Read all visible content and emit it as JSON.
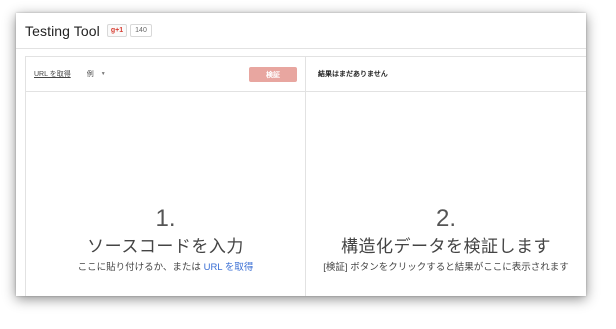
{
  "header": {
    "title": "Testing Tool",
    "gplus_label": "g+1",
    "plus_count": "140"
  },
  "left_pane": {
    "fetch_url_label": "URL を取得",
    "example_label": "例",
    "validate_label": "検証",
    "step_number": "1.",
    "step_title": "ソースコードを入力",
    "step_sub_prefix": "ここに貼り付けるか、または ",
    "step_sub_link": "URL を取得"
  },
  "right_pane": {
    "no_results_label": "結果はまだありません",
    "step_number": "2.",
    "step_title": "構造化データを検証します",
    "step_sub": "[検証] ボタンをクリックすると結果がここに表示されます"
  },
  "colors": {
    "validate_button": "#e8a6a0",
    "link": "#3b6fd4",
    "gplus_red": "#d73d32"
  }
}
